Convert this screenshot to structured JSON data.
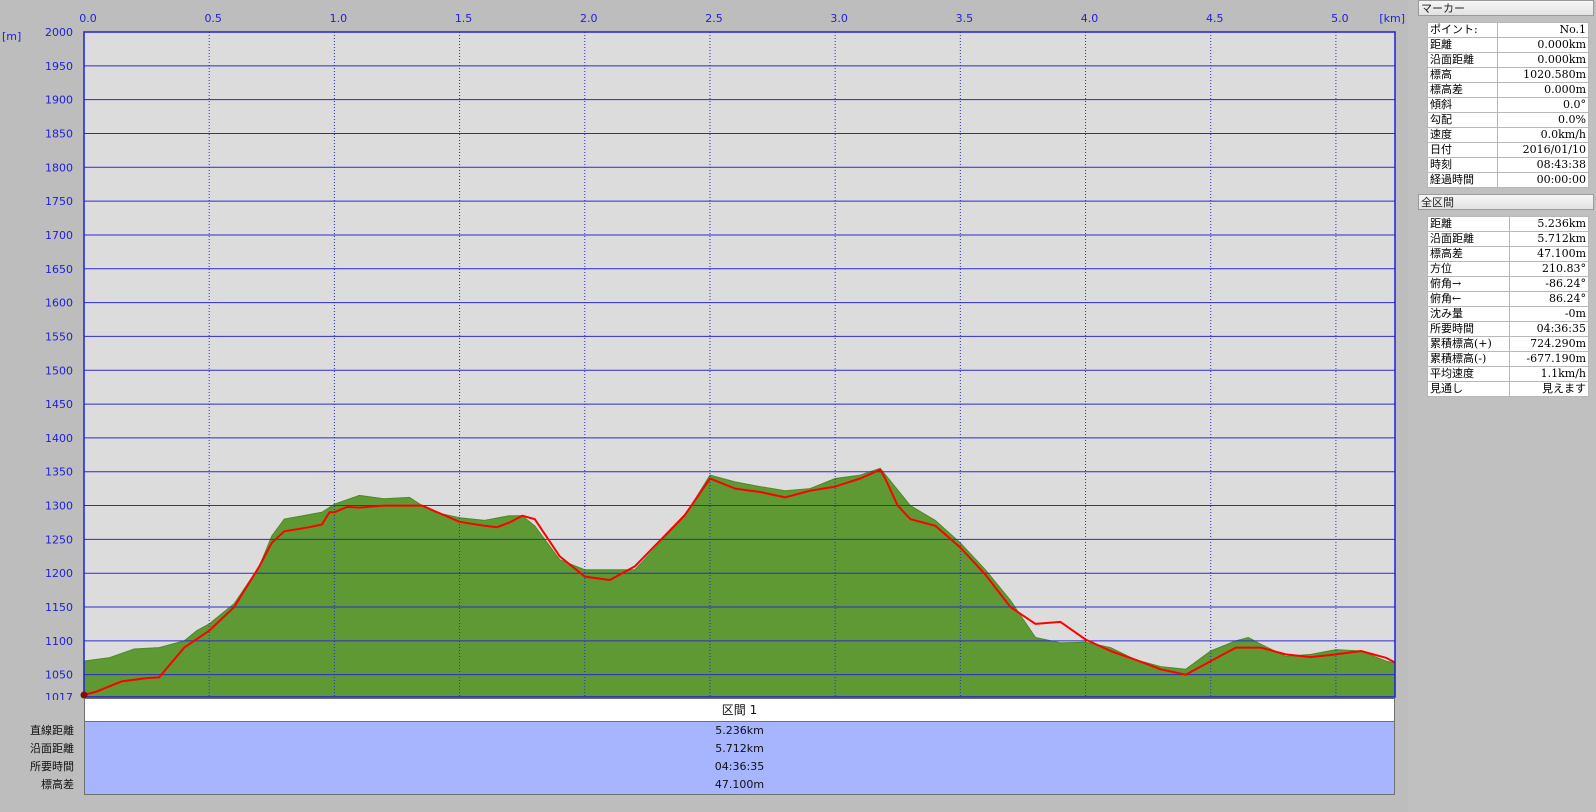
{
  "chart_data": {
    "type": "area",
    "xlabel_unit": "[km]",
    "ylabel_unit": "[m]",
    "xlim": [
      0,
      5.236
    ],
    "ylim": [
      1017,
      2000
    ],
    "x_ticks": [
      0.0,
      0.5,
      1.0,
      1.5,
      2.0,
      2.5,
      3.0,
      3.5,
      4.0,
      4.5,
      5.0
    ],
    "x_tick_labels": [
      "0.0",
      "0.5",
      "1.0",
      "1.5",
      "2.0",
      "2.5",
      "3.0",
      "3.5",
      "4.0",
      "4.5",
      "5.0"
    ],
    "y_ticks": [
      2000,
      1950,
      1900,
      1850,
      1800,
      1750,
      1700,
      1650,
      1600,
      1550,
      1500,
      1450,
      1400,
      1350,
      1300,
      1250,
      1200,
      1150,
      1100,
      1050,
      1017
    ],
    "y_tick_labels": [
      "2000",
      "1950",
      "1900",
      "1850",
      "1800",
      "1750",
      "1700",
      "1650",
      "1600",
      "1550",
      "1500",
      "1450",
      "1400",
      "1350",
      "1300",
      "1250",
      "1200",
      "1150",
      "1100",
      "1050",
      "1017"
    ],
    "grid": true,
    "colors": {
      "terrain": "#5f9933",
      "track": "#ff0000",
      "grid": "#2b2bcf",
      "plot_bg": "#dcdcdc"
    },
    "series": [
      {
        "kind": "terrain",
        "x": [
          0,
          0.1,
          0.2,
          0.3,
          0.4,
          0.45,
          0.5,
          0.6,
          0.7,
          0.75,
          0.8,
          0.95,
          1.0,
          1.1,
          1.2,
          1.3,
          1.35,
          1.4,
          1.5,
          1.6,
          1.7,
          1.75,
          1.8,
          1.9,
          2.0,
          2.1,
          2.2,
          2.3,
          2.4,
          2.5,
          2.6,
          2.7,
          2.8,
          2.9,
          3.0,
          3.1,
          3.18,
          3.3,
          3.4,
          3.5,
          3.6,
          3.7,
          3.8,
          3.9,
          4.0,
          4.1,
          4.2,
          4.3,
          4.4,
          4.5,
          4.6,
          4.65,
          4.7,
          4.8,
          4.9,
          5.0,
          5.1,
          5.2,
          5.236
        ],
        "y": [
          1070,
          1075,
          1088,
          1090,
          1100,
          1115,
          1125,
          1155,
          1210,
          1255,
          1280,
          1290,
          1302,
          1315,
          1310,
          1312,
          1300,
          1290,
          1282,
          1278,
          1285,
          1285,
          1270,
          1220,
          1205,
          1205,
          1205,
          1245,
          1285,
          1345,
          1335,
          1328,
          1322,
          1325,
          1340,
          1345,
          1355,
          1300,
          1278,
          1245,
          1205,
          1160,
          1105,
          1097,
          1098,
          1090,
          1072,
          1062,
          1058,
          1085,
          1100,
          1105,
          1095,
          1077,
          1080,
          1087,
          1085,
          1070,
          1067
        ]
      },
      {
        "kind": "track",
        "x": [
          0,
          0.05,
          0.15,
          0.25,
          0.3,
          0.4,
          0.5,
          0.6,
          0.7,
          0.75,
          0.8,
          0.9,
          0.95,
          0.98,
          1.0,
          1.05,
          1.1,
          1.2,
          1.3,
          1.35,
          1.4,
          1.5,
          1.6,
          1.65,
          1.7,
          1.75,
          1.8,
          1.9,
          2.0,
          2.1,
          2.2,
          2.3,
          2.4,
          2.5,
          2.6,
          2.7,
          2.8,
          2.9,
          3.0,
          3.1,
          3.18,
          3.2,
          3.25,
          3.3,
          3.4,
          3.5,
          3.6,
          3.7,
          3.8,
          3.9,
          4.0,
          4.1,
          4.2,
          4.3,
          4.4,
          4.5,
          4.6,
          4.7,
          4.8,
          4.9,
          5.0,
          5.1,
          5.2,
          5.236
        ],
        "y": [
          1020,
          1025,
          1040,
          1045,
          1046,
          1090,
          1115,
          1150,
          1210,
          1245,
          1262,
          1268,
          1272,
          1290,
          1290,
          1298,
          1297,
          1300,
          1300,
          1300,
          1292,
          1276,
          1270,
          1268,
          1275,
          1285,
          1280,
          1225,
          1195,
          1190,
          1210,
          1248,
          1286,
          1340,
          1325,
          1320,
          1312,
          1322,
          1328,
          1340,
          1353,
          1340,
          1300,
          1280,
          1270,
          1238,
          1198,
          1150,
          1125,
          1128,
          1102,
          1085,
          1072,
          1058,
          1050,
          1070,
          1090,
          1090,
          1080,
          1076,
          1080,
          1085,
          1075,
          1068
        ]
      }
    ]
  },
  "marker_panel": {
    "title": "マーカー",
    "rows": [
      {
        "label": "ポイント:",
        "value": "No.1"
      },
      {
        "label": "距離",
        "value": "0.000km"
      },
      {
        "label": "沿面距離",
        "value": "0.000km"
      },
      {
        "label": "標高",
        "value": "1020.580m"
      },
      {
        "label": "標高差",
        "value": "0.000m"
      },
      {
        "label": "傾斜",
        "value": "0.0°"
      },
      {
        "label": "勾配",
        "value": "0.0%"
      },
      {
        "label": "速度",
        "value": "0.0km/h"
      },
      {
        "label": "日付",
        "value": "2016/01/10"
      },
      {
        "label": "時刻",
        "value": "08:43:38"
      },
      {
        "label": "経過時間",
        "value": "00:00:00"
      }
    ]
  },
  "total_panel": {
    "title": "全区間",
    "rows": [
      {
        "label": "距離",
        "value": "5.236km"
      },
      {
        "label": "沿面距離",
        "value": "5.712km"
      },
      {
        "label": "標高差",
        "value": "47.100m"
      },
      {
        "label": "方位",
        "value": "210.83°"
      },
      {
        "label": "俯角→",
        "value": "-86.24°"
      },
      {
        "label": "俯角←",
        "value": "86.24°"
      },
      {
        "label": "沈み量",
        "value": "-0m"
      },
      {
        "label": "所要時間",
        "value": "04:36:35"
      },
      {
        "label": "累積標高(+)",
        "value": "724.290m"
      },
      {
        "label": "累積標高(-)",
        "value": "-677.190m"
      },
      {
        "label": "平均速度",
        "value": "1.1km/h"
      },
      {
        "label": "見通し",
        "value": "見えます"
      }
    ]
  },
  "section": {
    "title": "区間 1",
    "rows": [
      {
        "label": "直線距離",
        "value": "5.236km"
      },
      {
        "label": "沿面距離",
        "value": "5.712km"
      },
      {
        "label": "所要時間",
        "value": "04:36:35"
      },
      {
        "label": "標高差",
        "value": "47.100m"
      }
    ]
  }
}
